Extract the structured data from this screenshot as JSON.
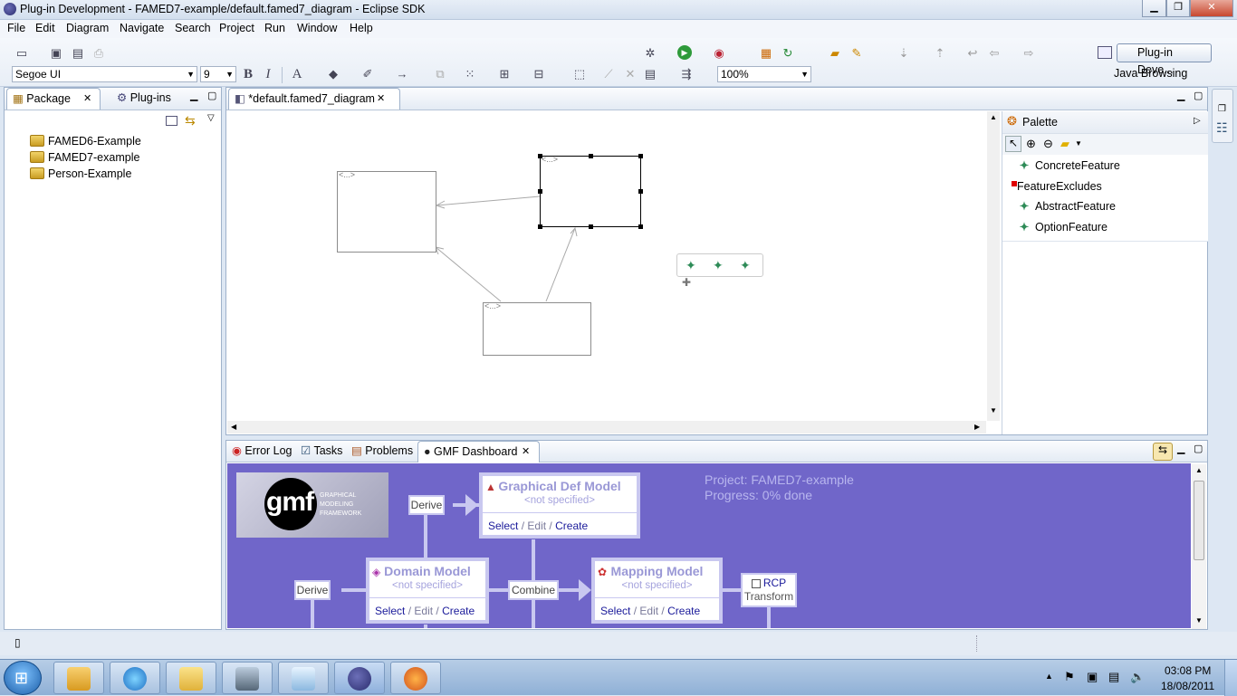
{
  "window": {
    "title": "Plug-in Development - FAMED7-example/default.famed7_diagram - Eclipse SDK"
  },
  "menu": [
    "File",
    "Edit",
    "Diagram",
    "Navigate",
    "Search",
    "Project",
    "Run",
    "Window",
    "Help"
  ],
  "toolbar": {
    "font_name": "Segoe UI",
    "font_size": "9",
    "bold_label": "B",
    "italic_label": "I",
    "zoom": "100%",
    "perspective_active": "Plug-in Deve...",
    "perspective_other": "Java Browsing"
  },
  "left_panel": {
    "tabs": [
      {
        "label": "Package"
      },
      {
        "label": "Plug-ins"
      }
    ],
    "tree": [
      {
        "label": "FAMED6-Example"
      },
      {
        "label": "FAMED7-example"
      },
      {
        "label": "Person-Example"
      }
    ]
  },
  "editor": {
    "tab_label": "*default.famed7_diagram",
    "node_label": "<...>",
    "popup_icons": [
      "concrete-feature-icon",
      "concrete-feature-icon",
      "concrete-feature-icon"
    ]
  },
  "palette": {
    "title": "Palette",
    "items": [
      {
        "label": "ConcreteFeature",
        "icon": "concrete-feature-icon"
      },
      {
        "label": "FeatureExcludes",
        "icon": "feature-excludes-icon",
        "color": "#e00000"
      },
      {
        "label": "AbstractFeature",
        "icon": "abstract-feature-icon"
      },
      {
        "label": "OptionFeature",
        "icon": "option-feature-icon"
      }
    ]
  },
  "bottom": {
    "tabs": [
      {
        "label": "Error Log"
      },
      {
        "label": "Tasks"
      },
      {
        "label": "Problems"
      },
      {
        "label": "GMF Dashboard"
      }
    ]
  },
  "dashboard": {
    "bg": "#7066c9",
    "logo_text": "gmf",
    "logo_caption": [
      "GRAPHICAL",
      "MODELING",
      "FRAMEWORK"
    ],
    "project": "Project: FAMED7-example",
    "progress": "Progress: 0% done",
    "graphical": {
      "title": "Graphical Def Model",
      "sub": "<not specified>"
    },
    "domain": {
      "title": "Domain Model",
      "sub": "<not specified>"
    },
    "mapping": {
      "title": "Mapping Model",
      "sub": "<not specified>"
    },
    "actions": {
      "select": "Select",
      "edit": "Edit",
      "create": "Create",
      "slash": "/"
    },
    "derive": "Derive",
    "combine": "Combine",
    "rcp": "RCP",
    "transform": "Transform"
  },
  "clock": {
    "time": "03:08 PM",
    "date": "18/08/2011"
  }
}
